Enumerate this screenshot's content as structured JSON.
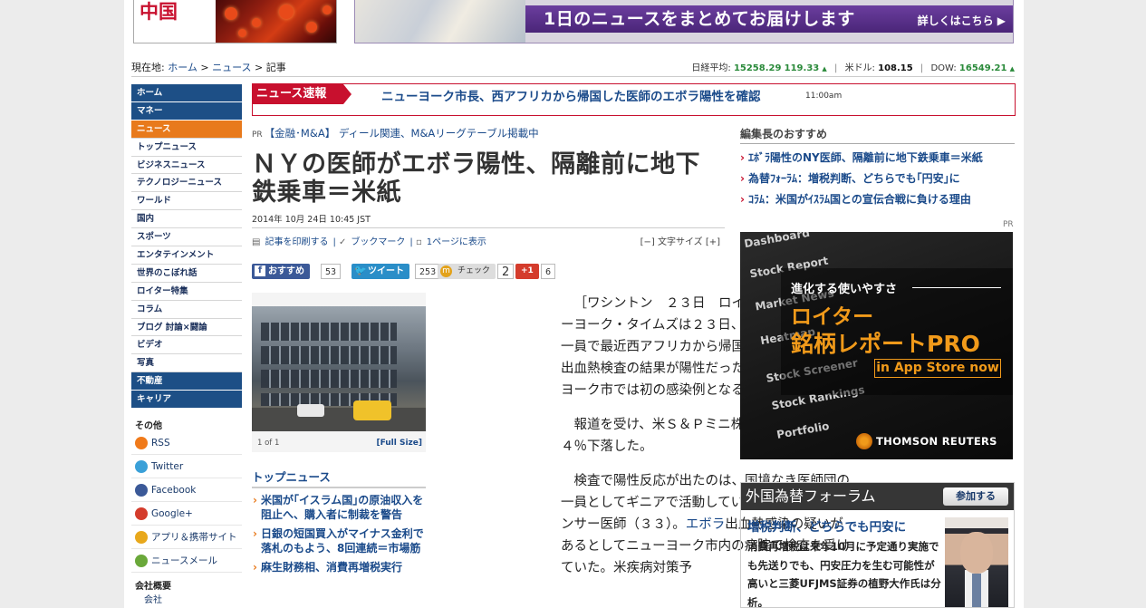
{
  "header": {
    "banner_left_label": "中国",
    "banner_right_text": "1日のニュースをまとめてお届けします",
    "banner_right_link": "詳しくはこちら ▶"
  },
  "breadcrumb": {
    "label": "現在地:",
    "items": [
      "ホーム",
      "ニュース",
      "記事"
    ],
    "separator": " > "
  },
  "market": {
    "nikkei_label": "日経平均:",
    "nikkei_value": "15258.29",
    "nikkei_change": "119.33",
    "usdjpy_label": "米ドル:",
    "usdjpy_value": "108.15",
    "dow_label": "DOW:",
    "dow_value": "16549.21",
    "up_arrow": "▲",
    "up_color": "#2a8a3a"
  },
  "nav": {
    "items": [
      {
        "label": "ホーム",
        "style": "sec"
      },
      {
        "label": "マネー",
        "style": "sec"
      },
      {
        "label": "ニュース",
        "style": "act"
      },
      {
        "label": "トップニュース",
        "style": ""
      },
      {
        "label": "ビジネスニュース",
        "style": ""
      },
      {
        "label": "テクノロジーニュース",
        "style": ""
      },
      {
        "label": "ワールド",
        "style": ""
      },
      {
        "label": "国内",
        "style": ""
      },
      {
        "label": "スポーツ",
        "style": ""
      },
      {
        "label": "エンタテインメント",
        "style": ""
      },
      {
        "label": "世界のこぼれ話",
        "style": ""
      },
      {
        "label": "ロイター特集",
        "style": ""
      },
      {
        "label": "コラム",
        "style": ""
      },
      {
        "label": "ブログ 討論×闘論",
        "style": ""
      },
      {
        "label": "ビデオ",
        "style": ""
      },
      {
        "label": "写真",
        "style": ""
      },
      {
        "label": "不動産",
        "style": "sec"
      },
      {
        "label": "キャリア",
        "style": "sec"
      }
    ],
    "other_title": "その他",
    "other": [
      {
        "label": "RSS",
        "icon": "rss-icon",
        "color": "#f07a1a"
      },
      {
        "label": "Twitter",
        "icon": "twitter-icon",
        "color": "#3aa0d8"
      },
      {
        "label": "Facebook",
        "icon": "facebook-icon",
        "color": "#3b5998"
      },
      {
        "label": "Google+",
        "icon": "googleplus-icon",
        "color": "#d43c2c"
      },
      {
        "label": "アプリ＆携帯サイト",
        "icon": "mobile-icon",
        "color": "#e8a81c"
      },
      {
        "label": "ニュースメール",
        "icon": "mail-icon",
        "color": "#6aa83a"
      }
    ],
    "company_title": "会社概要",
    "company_item": "会社"
  },
  "breaking": {
    "tag": "ニュース速報",
    "headline": "ニューヨーク市長、西アフリカから帰国した医師のエボラ陽性を確認",
    "time": "11:00am"
  },
  "article": {
    "pr_label": "PR",
    "pr_text": "【金融･M&A】 ディール関連、M&Aリーグテーブル掲載中",
    "title": "ＮＹの医師がエボラ陽性、隔離前に地下鉄乗車＝米紙",
    "date": "2014年 10月 24日 10:45 JST",
    "tools": {
      "print": "記事を印刷する",
      "bookmark": "ブックマーク",
      "onepage": "1ページに表示",
      "textsize": "[−] 文字サイズ [+]"
    },
    "social": {
      "fb_label": "おすすめ",
      "fb_count": "53",
      "tw_label": "ツイート",
      "tw_count": "253",
      "check_label": "チェック",
      "check_count": "2",
      "gplus_label": "+1",
      "gplus_count": "6"
    },
    "photo_caption": "1 of 1",
    "photo_fullsize": "[Full Size]",
    "paragraphs": [
      "［ワシントン　２３日　ロイター］ - 米紙ニューヨーク・タイムズは２３日、国境なき医師団の一員で最近西アフリカから帰国した医師のエボラ出血熱検査の結果が陽性だったと報じた。ニューヨーク市では初の感染例となる。",
      "報道を受け、米Ｓ＆Ｐミニ株価先物取引は０．４％下落した。",
      "検査で陽性反応が出たのは、国境なき医師団の一員としてギニアで活動していたクレイグ・スペンサー医師（３３）。エボラ出血熱感染の疑いがあるとしてニューヨーク市内の病院で検査を受けていた。米疾病対策予"
    ]
  },
  "top_news": {
    "title": "トップニュース",
    "items": [
      "米国が｢イスラム国｣の原油収入を阻止へ、購入者に制裁を警告",
      "日銀の短国買入がマイナス金利で落札のもよう、8回連続＝市場筋",
      "麻生財務相、消費再増税実行"
    ]
  },
  "editor_picks": {
    "title": "編集長のおすすめ",
    "items": [
      "ｴﾎﾞﾗ陽性のNY医師、隔離前に地下鉄乗車＝米紙",
      "為替ﾌｫｰﾗﾑ：増税判断、どちらでも｢円安｣に",
      "ｺﾗﾑ：米国がｲｽﾗﾑ国との宣伝合戦に負ける理由"
    ],
    "pr_label": "PR"
  },
  "ad": {
    "menu_items": [
      "Dashboard",
      "Stock Report",
      "Market News",
      "Heatmap",
      "Stock Screener",
      "Stock Rankings",
      "Portfolio"
    ],
    "headline": "進化する使いやすさ",
    "line2": "ロイター",
    "line3": "銘柄レポートPRO",
    "button": "in App Store now",
    "brand": "THOMSON REUTERS"
  },
  "forum": {
    "header": "外国為替フォーラム",
    "join": "参加する",
    "title": "増税判断、どちらでも円安に",
    "body": "消費再増税は来年10月に予定通り実施でも先送りでも、円安圧力を生む可能性が高いと三菱UFJMS証券の植野大作氏は分析。"
  }
}
